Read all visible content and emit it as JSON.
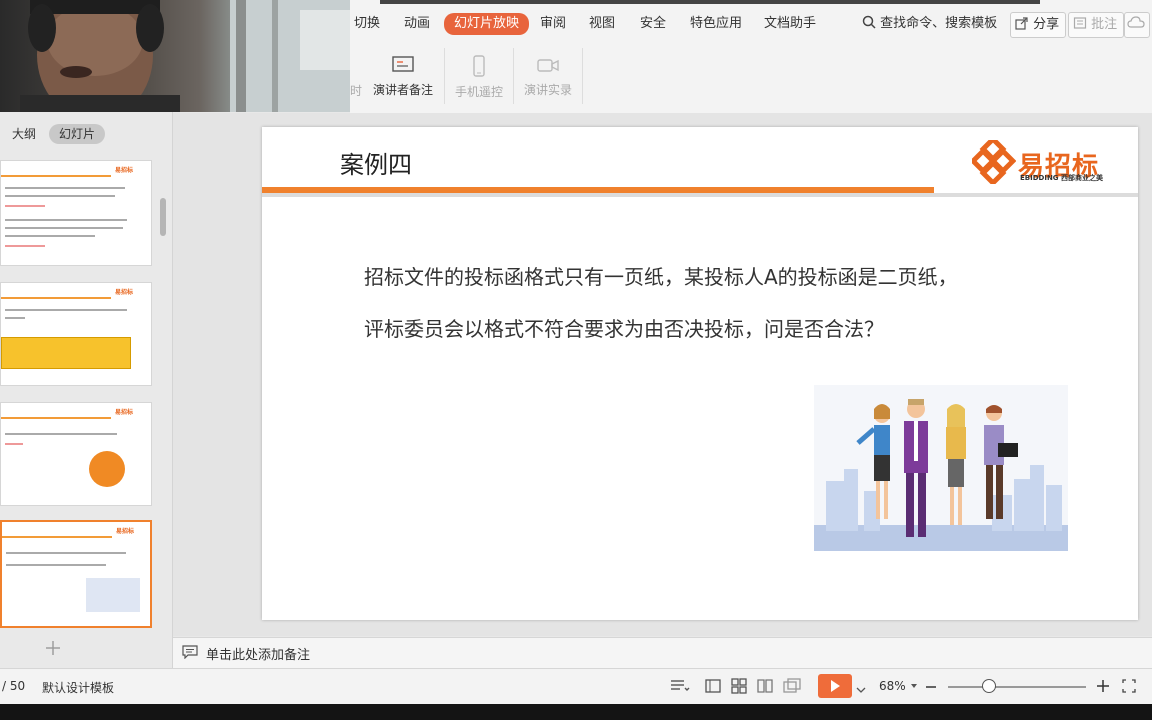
{
  "ribbon_tabs": [
    "切换",
    "动画",
    "幻灯片放映",
    "审阅",
    "视图",
    "安全",
    "特色应用",
    "文档助手"
  ],
  "active_tab": "幻灯片放映",
  "search": {
    "label": "查找命令、搜索模板",
    "icon": "search-icon"
  },
  "top_buttons": {
    "share": "分享",
    "comment": "批注"
  },
  "ribbon_items": {
    "partial": "时",
    "speaker_notes": "演讲者备注",
    "phone_remote": "手机遥控",
    "presentation_record": "演讲实录"
  },
  "left_panel": {
    "tabs": [
      "大纲",
      "幻灯片"
    ],
    "active_tab": "幻灯片"
  },
  "slide": {
    "title": "案例四",
    "body": [
      "招标文件的投标函格式只有一页纸，某投标人A的投标函是二页纸，",
      "评标委员会以格式不符合要求为由否决投标，问是否合法？"
    ],
    "logo_text": "易招标",
    "logo_sub": "EBIDDING 西部商业之美",
    "colors": {
      "accent": "#f0812d",
      "logo": "#e8661e"
    }
  },
  "notes_placeholder": "单击此处添加备注",
  "status": {
    "page": "/ 50",
    "template": "默认设计模板",
    "zoom": "68%",
    "zoom_level": 0.3
  }
}
